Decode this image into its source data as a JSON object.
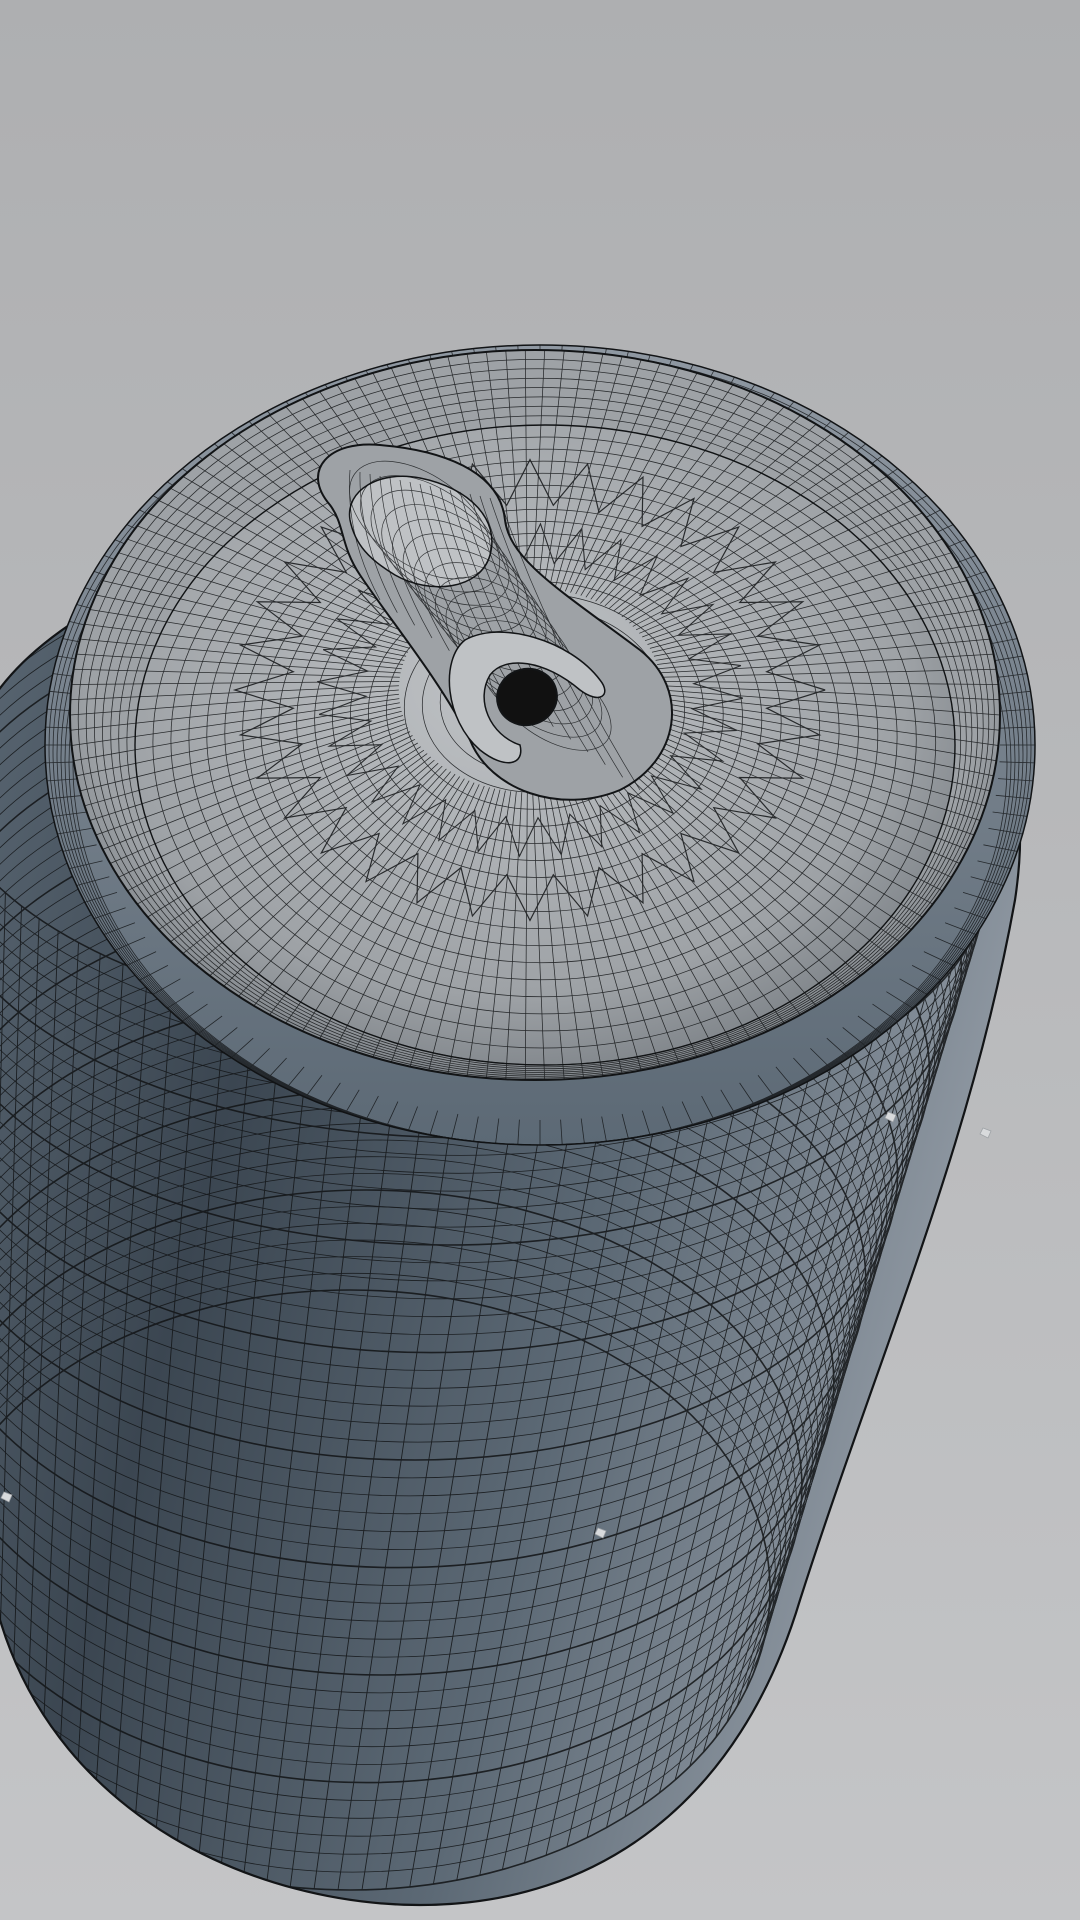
{
  "scene": {
    "subject": "wireframe-mesh-soda-can",
    "view": "top-down-perspective",
    "colors": {
      "background_top": "#aeafb1",
      "background_bottom": "#c4c5c7",
      "body_light": "#8f98a2",
      "body_mid": "#5c6975",
      "body_dark": "#3b4651",
      "lid_light": "#bfc2c5",
      "lid_mid": "#9ea2a6",
      "lid_dark": "#6f757b",
      "wire": "#121416",
      "drink_hole": "#111111"
    }
  }
}
